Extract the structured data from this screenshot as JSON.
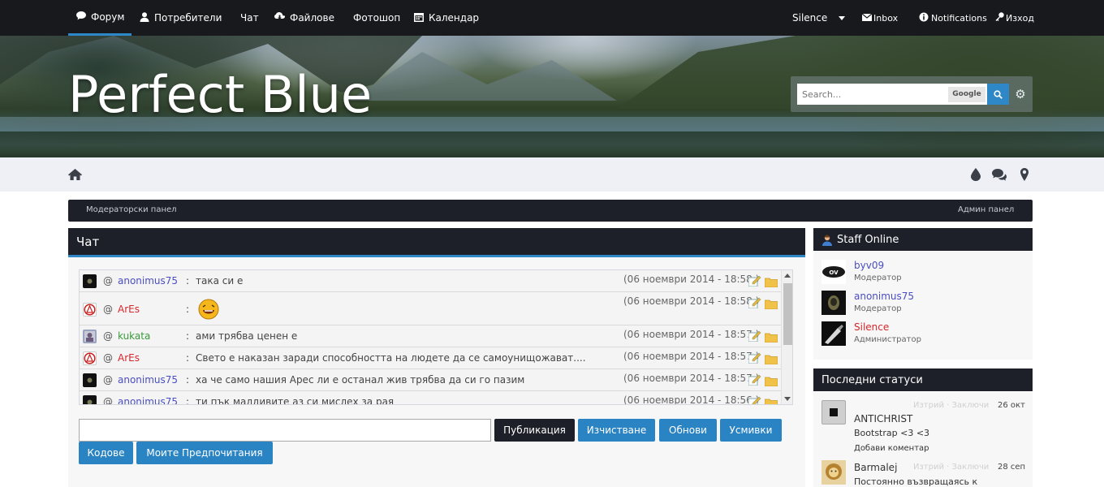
{
  "nav": {
    "items": [
      {
        "label": "Форум",
        "icon": "speech-bubble-icon"
      },
      {
        "label": "Потребители",
        "icon": "user-icon"
      },
      {
        "label": "Чат",
        "icon": ""
      },
      {
        "label": "Файлове",
        "icon": "cloud-download-icon"
      },
      {
        "label": "Фотошоп",
        "icon": ""
      },
      {
        "label": "Календар",
        "icon": "calendar-icon"
      }
    ],
    "user": "Silence",
    "inbox": "Inbox",
    "notifications": "Notifications",
    "logout": "Изход"
  },
  "header": {
    "site_title": "Perfect Blue",
    "search_placeholder": "Search...",
    "google_label": "Google"
  },
  "modbar": {
    "left": "Модераторски панел",
    "right": "Админ панел"
  },
  "chat": {
    "title": "Чат",
    "rows": [
      {
        "at": "@",
        "user": "anonimus75",
        "user_color": "#4a4ec0",
        "colon": ":",
        "message": "така си е",
        "time": "(06 ноември 2014 - 18:58 )"
      },
      {
        "at": "@",
        "user": "ArEs",
        "user_color": "#d9262c",
        "colon": ":",
        "message": "",
        "emoji": "laughing-smiley",
        "time": "(06 ноември 2014 - 18:58 )"
      },
      {
        "at": "@",
        "user": "kukata",
        "user_color": "#3a9a3a",
        "colon": ":",
        "message": "ами трябва ценен е",
        "time": "(06 ноември 2014 - 18:57 )"
      },
      {
        "at": "@",
        "user": "ArEs",
        "user_color": "#d9262c",
        "colon": ":",
        "message": "Свето е наказан заради способността на людете да се самоунищожават....",
        "time": "(06 ноември 2014 - 18:57 )"
      },
      {
        "at": "@",
        "user": "anonimus75",
        "user_color": "#4a4ec0",
        "colon": ":",
        "message": "ха че само нашия Арес ли е останал жив трябва да си го пазим",
        "time": "(06 ноември 2014 - 18:57 )"
      },
      {
        "at": "@",
        "user": "anonimus75",
        "user_color": "#4a4ec0",
        "colon": ":",
        "message": "ти пък малдивите аз си мислех за рая",
        "time": "(06 ноември 2014 - 18:56 )"
      }
    ],
    "buttons": {
      "publish": "Публикация",
      "clear": "Изчистване",
      "refresh": "Обнови",
      "smilies": "Усмивки",
      "codes": "Кодове",
      "prefs": "Моите Предпочитания"
    }
  },
  "staff": {
    "title": "Staff Online",
    "members": [
      {
        "name": "byv09",
        "role": "Модератор",
        "color": "#4a4ec0"
      },
      {
        "name": "anonimus75",
        "role": "Модератор",
        "color": "#4a4ec0"
      },
      {
        "name": "Silence",
        "role": "Администратор",
        "color": "#d9262c"
      }
    ]
  },
  "statuses": {
    "title": "Последни статуси",
    "items": [
      {
        "ghost": "Изтрий · Заключи",
        "date": "26 окт",
        "name": "ANTICHRIST",
        "text": "Bootstrap <3 <3",
        "link": "Добави коментар"
      },
      {
        "ghost": "Изтрий · Заключи",
        "date": "28 сеп",
        "name": "Barmalej",
        "text": "Постоянно възвращаясь к"
      }
    ]
  },
  "colors": {
    "accent": "#2e87c7",
    "dark": "#1d2028",
    "moderator": "#4a4ec0",
    "admin": "#d9262c",
    "member": "#3a9a3a"
  }
}
